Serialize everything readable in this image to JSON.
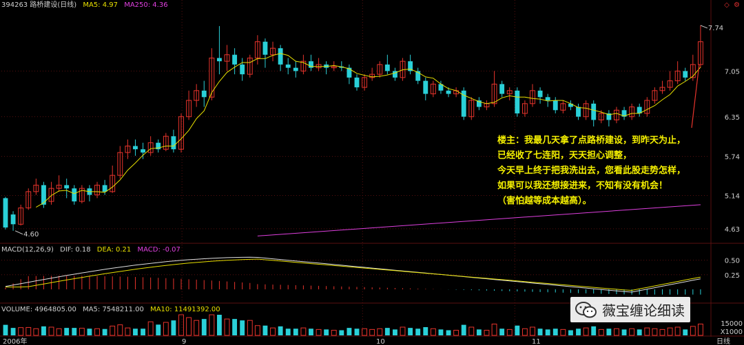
{
  "header": {
    "code_name": "394263 路桥建设(日线)",
    "ma5": "MA5: 4.97",
    "ma250": "MA250: 4.36"
  },
  "macd_header": {
    "label": "MACD(12,26,9)",
    "dif": "DIF: 0.18",
    "dea": "DEA: 0.21",
    "macd": "MACD: -0.07"
  },
  "volume_header": {
    "label": "VOLUME: 4964805.00",
    "ma5": "MA5: 7548211.00",
    "ma10": "MA10: 11491392.00"
  },
  "annotation": {
    "lines": [
      "楼主：我最几天拿了点路桥建设，到昨天为止，",
      "已经收了七连阳，天天担心调整，",
      "今天早上终于把我洗出去，您看此股走势怎样，",
      "如果可以我还想接进来，不知有没有机会！",
      "（害怕越等成本越高）。"
    ]
  },
  "brand": {
    "text": "薇宝缠论细读",
    "icon": "wechat-icon"
  },
  "top_icons": [
    "diamond-icon",
    "settings-icon"
  ],
  "colors": {
    "up": "#e8342c",
    "down": "#2ad0d8",
    "ma5": "#e8e000",
    "ma250": "#e040e0",
    "dif": "#e0e0e0",
    "dea": "#e8e000",
    "grid": "#5a1010"
  },
  "chart_data": [
    {
      "type": "candlestick",
      "title": "394263 路桥建设(日线)",
      "ylabel": "",
      "y_ticks": [
        4.63,
        5.14,
        5.74,
        6.35,
        7.05
      ],
      "ylim": [
        4.45,
        7.95
      ],
      "x_labels": [
        "2006年",
        "9",
        "10",
        "11",
        "日线"
      ],
      "annotations": [
        {
          "label": "7.74"
        },
        {
          "label": "4.60"
        }
      ],
      "series": [
        {
          "name": "MA5",
          "ma_period": 5
        },
        {
          "name": "MA250",
          "values_start": 4.52,
          "values_end": 5.0
        }
      ],
      "candles": [
        [
          5.1,
          4.65,
          5.12,
          4.62
        ],
        [
          4.85,
          4.7,
          4.9,
          4.6
        ],
        [
          4.7,
          4.95,
          5.0,
          4.68
        ],
        [
          4.95,
          5.2,
          5.25,
          4.92
        ],
        [
          5.2,
          5.3,
          5.4,
          5.15
        ],
        [
          5.3,
          5.0,
          5.35,
          4.95
        ],
        [
          5.05,
          5.25,
          5.35,
          5.0
        ],
        [
          5.25,
          5.3,
          5.45,
          5.2
        ],
        [
          5.3,
          5.25,
          5.4,
          5.1
        ],
        [
          5.25,
          5.05,
          5.3,
          5.0
        ],
        [
          5.05,
          5.25,
          5.3,
          5.02
        ],
        [
          5.25,
          5.15,
          5.3,
          5.05
        ],
        [
          5.15,
          5.3,
          5.35,
          5.1
        ],
        [
          5.3,
          5.2,
          5.38,
          5.15
        ],
        [
          5.2,
          5.45,
          5.6,
          5.18
        ],
        [
          5.45,
          5.8,
          5.9,
          5.4
        ],
        [
          5.8,
          5.9,
          6.0,
          5.7
        ],
        [
          5.9,
          5.85,
          6.0,
          5.75
        ],
        [
          5.85,
          5.8,
          5.95,
          5.7
        ],
        [
          5.8,
          5.95,
          6.05,
          5.75
        ],
        [
          5.95,
          5.85,
          6.0,
          5.8
        ],
        [
          5.85,
          6.05,
          6.1,
          5.82
        ],
        [
          6.05,
          5.85,
          6.15,
          5.8
        ],
        [
          5.85,
          6.35,
          6.4,
          5.8
        ],
        [
          6.35,
          6.6,
          6.75,
          6.3
        ],
        [
          6.6,
          6.75,
          6.85,
          6.5
        ],
        [
          6.75,
          6.65,
          6.9,
          6.5
        ],
        [
          6.65,
          7.25,
          7.4,
          6.6
        ],
        [
          7.25,
          7.2,
          7.74,
          7.0
        ],
        [
          7.2,
          7.3,
          7.45,
          7.05
        ],
        [
          7.3,
          7.15,
          7.4,
          7.0
        ],
        [
          7.15,
          7.0,
          7.25,
          6.9
        ],
        [
          7.0,
          7.25,
          7.3,
          6.95
        ],
        [
          7.25,
          7.5,
          7.6,
          7.15
        ],
        [
          7.5,
          7.3,
          7.55,
          7.1
        ],
        [
          7.3,
          7.4,
          7.5,
          7.2
        ],
        [
          7.4,
          7.15,
          7.45,
          7.05
        ],
        [
          7.15,
          7.1,
          7.25,
          7.0
        ],
        [
          7.1,
          7.05,
          7.2,
          6.95
        ],
        [
          7.05,
          7.2,
          7.3,
          7.0
        ],
        [
          7.2,
          7.1,
          7.3,
          7.05
        ],
        [
          7.1,
          7.15,
          7.25,
          7.05
        ],
        [
          7.15,
          7.1,
          7.2,
          7.0
        ],
        [
          7.1,
          7.12,
          7.2,
          7.05
        ],
        [
          7.12,
          7.1,
          7.2,
          7.05
        ],
        [
          7.1,
          6.95,
          7.15,
          6.85
        ],
        [
          6.95,
          6.8,
          7.0,
          6.75
        ],
        [
          6.8,
          6.95,
          7.0,
          6.75
        ],
        [
          6.95,
          7.0,
          7.1,
          6.9
        ],
        [
          7.0,
          7.15,
          7.2,
          6.95
        ],
        [
          7.15,
          7.05,
          7.3,
          7.0
        ],
        [
          7.05,
          6.95,
          7.1,
          6.9
        ],
        [
          6.95,
          7.2,
          7.25,
          6.9
        ],
        [
          7.2,
          7.05,
          7.3,
          7.0
        ],
        [
          7.05,
          6.9,
          7.1,
          6.85
        ],
        [
          6.9,
          6.7,
          6.95,
          6.6
        ],
        [
          6.7,
          6.85,
          6.9,
          6.65
        ],
        [
          6.85,
          6.75,
          6.9,
          6.7
        ],
        [
          6.75,
          6.7,
          6.8,
          6.65
        ],
        [
          6.7,
          6.75,
          6.8,
          6.65
        ],
        [
          6.75,
          6.35,
          6.8,
          6.3
        ],
        [
          6.35,
          6.6,
          6.65,
          6.3
        ],
        [
          6.6,
          6.5,
          6.65,
          6.45
        ],
        [
          6.5,
          6.55,
          6.6,
          6.45
        ],
        [
          6.55,
          6.85,
          7.05,
          6.5
        ],
        [
          6.85,
          6.7,
          6.9,
          6.65
        ],
        [
          6.7,
          6.75,
          6.8,
          6.6
        ],
        [
          6.75,
          6.4,
          6.8,
          6.35
        ],
        [
          6.4,
          6.55,
          6.6,
          6.35
        ],
        [
          6.55,
          6.75,
          6.85,
          6.5
        ],
        [
          6.75,
          6.65,
          6.8,
          6.55
        ],
        [
          6.65,
          6.6,
          6.7,
          6.5
        ],
        [
          6.6,
          6.45,
          6.65,
          6.4
        ],
        [
          6.45,
          6.55,
          6.6,
          6.4
        ],
        [
          6.55,
          6.5,
          6.6,
          6.45
        ],
        [
          6.5,
          6.35,
          6.55,
          6.3
        ],
        [
          6.35,
          6.55,
          6.6,
          6.3
        ],
        [
          6.55,
          6.3,
          6.6,
          6.2
        ],
        [
          6.3,
          6.4,
          6.45,
          6.25
        ],
        [
          6.4,
          6.3,
          6.45,
          6.2
        ],
        [
          6.3,
          6.45,
          6.5,
          6.25
        ],
        [
          6.45,
          6.35,
          6.5,
          6.3
        ],
        [
          6.35,
          6.5,
          6.55,
          6.3
        ],
        [
          6.5,
          6.4,
          6.55,
          6.35
        ],
        [
          6.4,
          6.6,
          6.65,
          6.35
        ],
        [
          6.6,
          6.75,
          6.8,
          6.55
        ],
        [
          6.75,
          6.8,
          6.9,
          6.7
        ],
        [
          6.8,
          6.9,
          7.05,
          6.75
        ],
        [
          6.9,
          7.05,
          7.2,
          6.85
        ],
        [
          7.05,
          6.95,
          7.1,
          6.9
        ],
        [
          6.95,
          7.15,
          7.3,
          6.9
        ],
        [
          7.15,
          7.5,
          7.75,
          7.1
        ]
      ]
    },
    {
      "type": "bar",
      "title": "MACD(12,26,9)",
      "y_ticks": [
        0.25,
        0.5
      ],
      "ylim": [
        -0.2,
        0.6
      ],
      "series": [
        {
          "name": "DIF",
          "start": 0.05,
          "peak": 0.55,
          "end": 0.18
        },
        {
          "name": "DEA",
          "start": 0.04,
          "peak": 0.52,
          "end": 0.21
        },
        {
          "name": "MACD",
          "last": -0.07
        }
      ]
    },
    {
      "type": "bar",
      "title": "VOLUME",
      "y_ticks": [
        15000
      ],
      "unit_label": "X1000",
      "series": [
        {
          "name": "VOLUME",
          "last": 4964805.0
        },
        {
          "name": "MA5",
          "last": 7548211.0
        },
        {
          "name": "MA10",
          "last": 11491392.0
        }
      ]
    }
  ]
}
